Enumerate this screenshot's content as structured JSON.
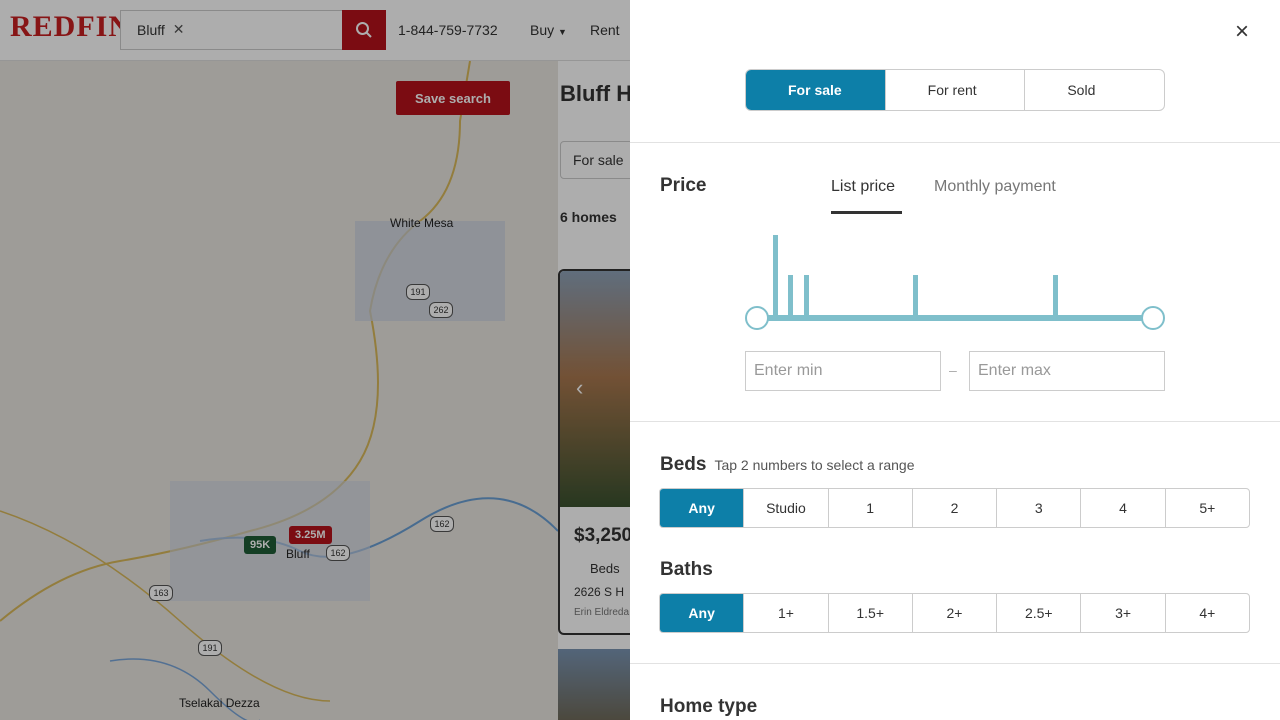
{
  "header": {
    "logo": "REDFIN",
    "search_chip": "Bluff",
    "phone": "1-844-759-7732",
    "nav_buy": "Buy",
    "nav_rent": "Rent"
  },
  "map": {
    "save_search": "Save search",
    "place_labels": [
      "White Mesa",
      "Bluff",
      "Tselakai Dezza"
    ],
    "shields": [
      "191",
      "262",
      "162",
      "163",
      "162",
      "191"
    ],
    "pins": [
      "95K",
      "3.25M"
    ]
  },
  "results": {
    "title": "Bluff H",
    "for_sale": "For sale",
    "count": "6 homes",
    "card": {
      "price": "$3,250",
      "beds": "Beds",
      "address": "2626 S H",
      "agent": "Erin Eldreda"
    }
  },
  "filters": {
    "listing_types": [
      "For sale",
      "For rent",
      "Sold"
    ],
    "active_listing_type": "For sale",
    "price": {
      "title": "Price",
      "tabs": [
        "List price",
        "Monthly payment"
      ],
      "active_tab": "List price",
      "min_placeholder": "Enter min",
      "max_placeholder": "Enter max",
      "range_separator": "–"
    },
    "beds": {
      "title": "Beds",
      "hint": "Tap 2 numbers to select a range",
      "options": [
        "Any",
        "Studio",
        "1",
        "2",
        "3",
        "4",
        "5+"
      ],
      "selected": "Any"
    },
    "baths": {
      "title": "Baths",
      "options": [
        "Any",
        "1+",
        "1.5+",
        "2+",
        "2.5+",
        "3+",
        "4+"
      ],
      "selected": "Any"
    },
    "home_type": {
      "title": "Home type"
    }
  },
  "colors": {
    "brand_red": "#b5121b",
    "accent_teal": "#0d7fa8",
    "slider": "#7fbfcb"
  }
}
